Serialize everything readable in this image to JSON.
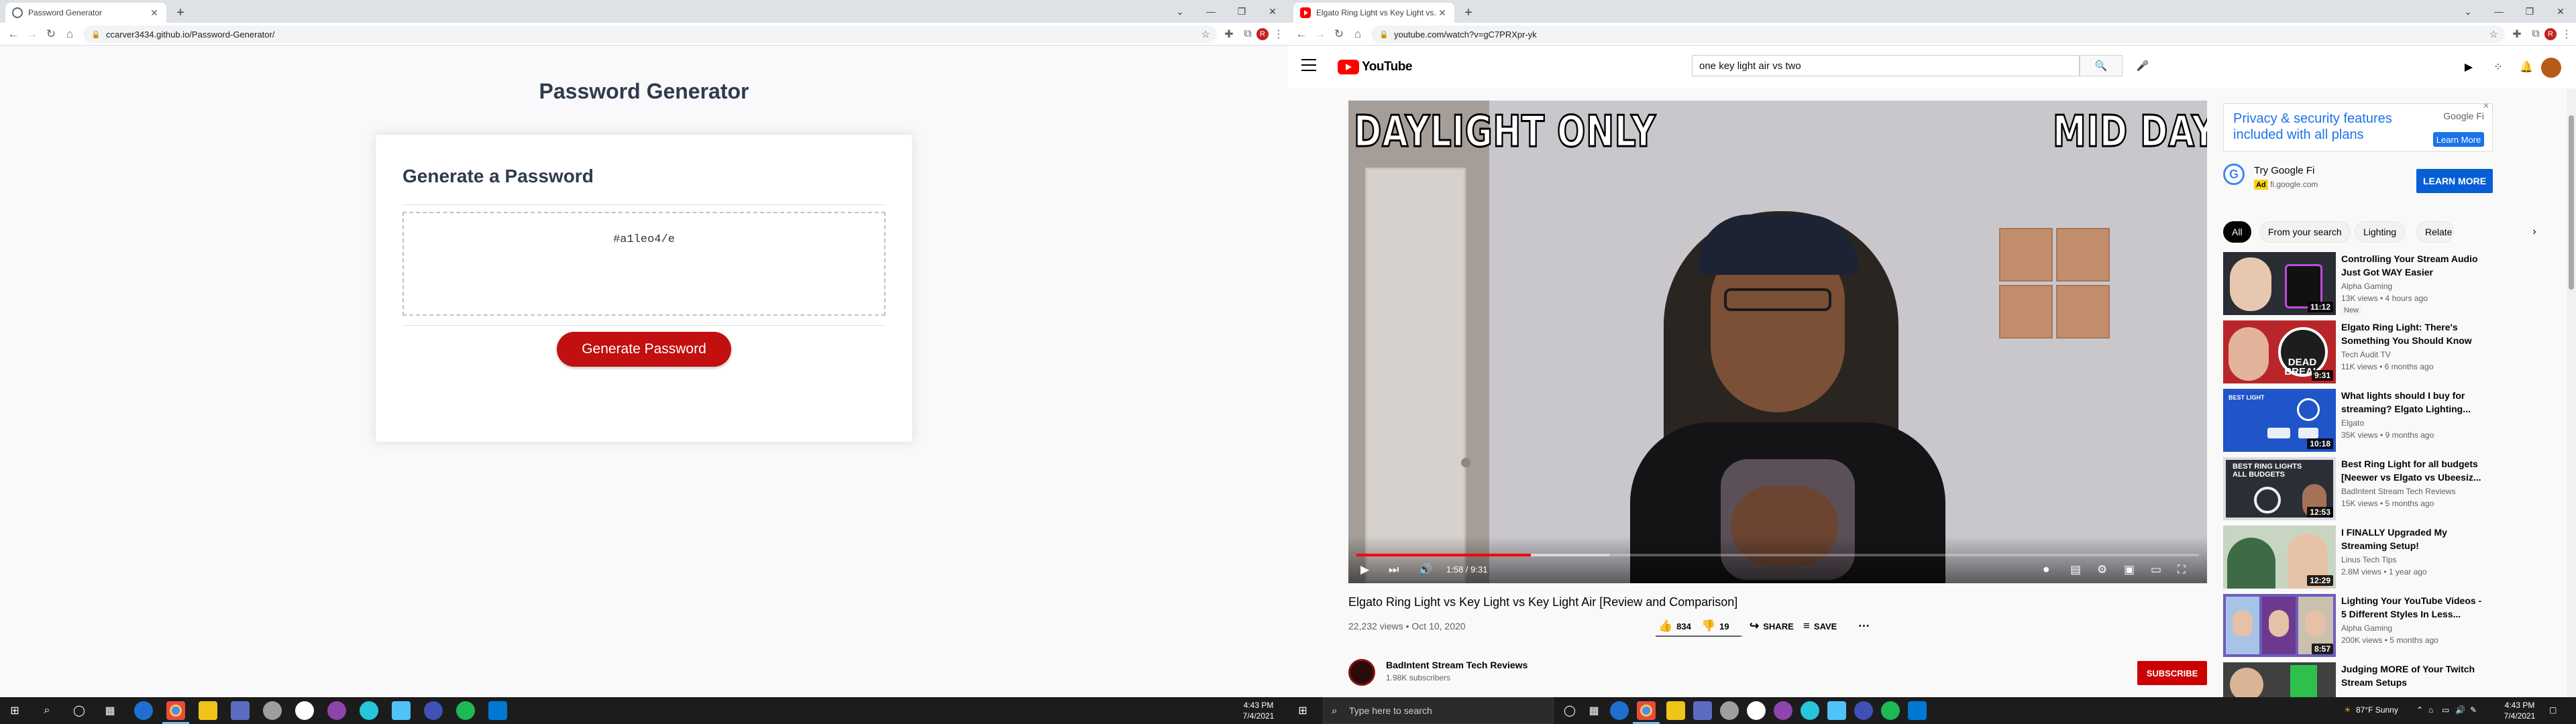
{
  "left_window": {
    "tab": {
      "title": "Password Generator",
      "favicon": "globe-icon"
    },
    "url": "ccarver3434.github.io/Password-Generator/",
    "page": {
      "heading": "Password Generator",
      "card_title": "Generate a Password",
      "password": "#a1leo4/e",
      "button": "Generate Password",
      "accent": "#c20f0f"
    }
  },
  "right_window": {
    "tab": {
      "title": "Elgato Ring Light vs Key Light vs...",
      "favicon": "youtube-icon"
    },
    "url": "youtube.com/watch?v=gC7PRXpr-yk",
    "youtube": {
      "logo": "YouTube",
      "search_value": "one key light air vs two",
      "player": {
        "overlay_left": "DAYLIGHT ONLY",
        "overlay_right": "MID DAY",
        "time": "1:58 / 9:31",
        "played_fraction": 0.207,
        "loaded_fraction": 0.3
      },
      "video": {
        "title": "Elgato Ring Light vs Key Light vs Key Light Air [Review and Comparison]",
        "views": "22,232 views • Oct 10, 2020",
        "likes": "834",
        "dislikes": "19",
        "share": "SHARE",
        "save": "SAVE",
        "like_fraction": 0.978
      },
      "channel": {
        "name": "BadIntent Stream Tech Reviews",
        "subs": "1.98K subscribers",
        "subscribe": "SUBSCRIBE"
      },
      "ad_banner": {
        "text": "Privacy & security features included with all plans",
        "brand": "Google Fi",
        "button": "Learn More"
      },
      "ad": {
        "title": "Try Google Fi",
        "tag": "Ad",
        "domain": "fi.google.com",
        "cta": "LEARN MORE"
      },
      "chips": [
        "All",
        "From your search",
        "Lighting",
        "Relate"
      ],
      "recommendations": [
        {
          "title": "Controlling Your Stream Audio Just Got WAY Easier",
          "channel": "Alpha Gaming",
          "meta": "13K views • 4 hours ago",
          "duration": "11:12",
          "badge": "New"
        },
        {
          "title": "Elgato Ring Light: There's Something You Should Know",
          "channel": "Tech Audit TV",
          "meta": "11K views • 6 months ago",
          "duration": "9:31",
          "badge": ""
        },
        {
          "title": "What lights should I buy for streaming? Elgato Lighting...",
          "channel": "Elgato",
          "meta": "35K views • 9 months ago",
          "duration": "10:18",
          "badge": ""
        },
        {
          "title": "Best Ring Light for all budgets [Neewer vs Elgato vs Ubeesiz...",
          "channel": "BadIntent Stream Tech Reviews",
          "meta": "15K views • 5 months ago",
          "duration": "12:53",
          "badge": ""
        },
        {
          "title": "I FINALLY Upgraded My Streaming Setup!",
          "channel": "Linus Tech Tips",
          "meta": "2.8M views • 1 year ago",
          "duration": "12:29",
          "badge": ""
        },
        {
          "title": "Lighting Your YouTube Videos - 5 Different Styles In Less...",
          "channel": "Alpha Gaming",
          "meta": "200K views • 5 months ago",
          "duration": "8:57",
          "badge": ""
        },
        {
          "title": "Judging MORE of Your Twitch Stream Setups",
          "channel": "",
          "meta": "",
          "duration": "",
          "badge": ""
        }
      ],
      "thumb_texts": {
        "t1": "DEAD BREAK",
        "t2": "BEST LIGHT",
        "t3": "BEST RING LIGHTS ALL BUDGETS"
      }
    }
  },
  "taskbar_left": {
    "time": "4:43 PM",
    "date": "7/4/2021"
  },
  "taskbar_right": {
    "search_placeholder": "Type here to search",
    "weather": "87°F  Sunny",
    "time": "4:43 PM",
    "date": "7/4/2021"
  }
}
